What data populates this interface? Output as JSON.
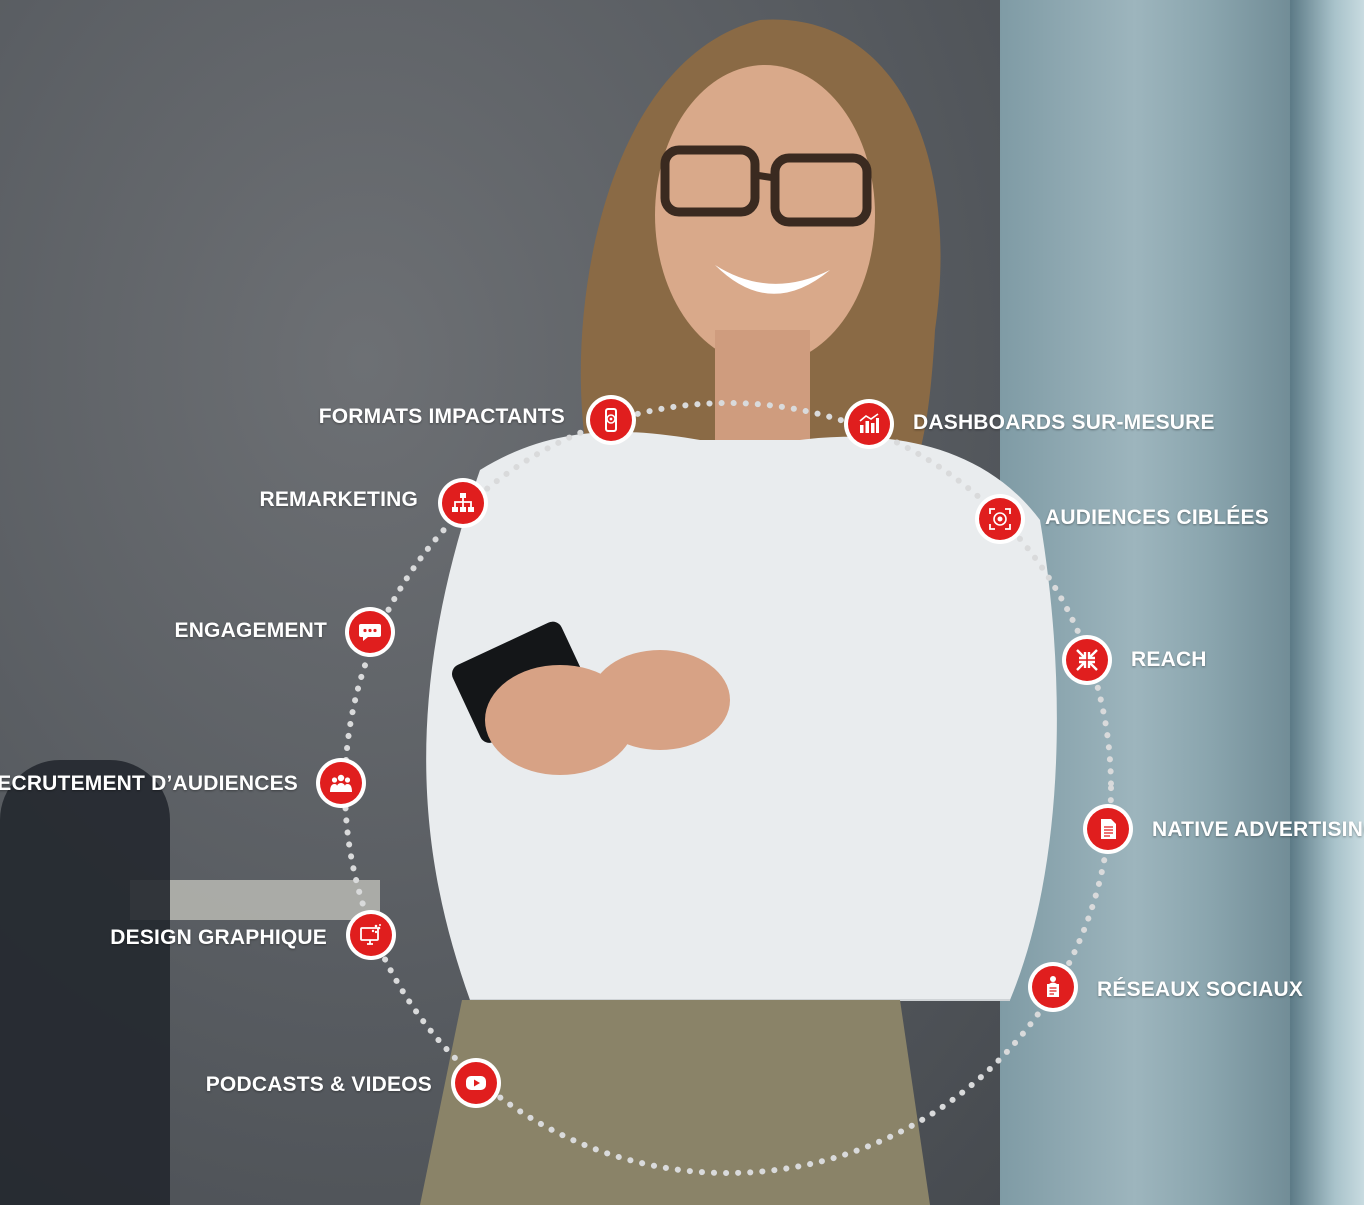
{
  "services": [
    {
      "label": "FORMATS IMPACTANTS",
      "icon": "mobile-target-icon"
    },
    {
      "label": "DASHBOARDS SUR-MESURE",
      "icon": "bar-chart-icon"
    },
    {
      "label": "REMARKETING",
      "icon": "sitemap-icon"
    },
    {
      "label": "AUDIENCES CIBLÉES",
      "icon": "target-icon"
    },
    {
      "label": "ENGAGEMENT",
      "icon": "chat-bubble-icon"
    },
    {
      "label": "REACH",
      "icon": "arrows-in-icon"
    },
    {
      "label": "RECRUTEMENT D’AUDIENCES",
      "icon": "people-group-icon"
    },
    {
      "label": "NATIVE ADVERTISING",
      "icon": "document-icon"
    },
    {
      "label": "DESIGN GRAPHIQUE",
      "icon": "monitor-design-icon"
    },
    {
      "label": "RÉSEAUX SOCIAUX",
      "icon": "profile-card-icon"
    },
    {
      "label": "PODCASTS & VIDEOS",
      "icon": "play-button-icon"
    }
  ],
  "colors": {
    "accent": "#e01e1e",
    "label": "#ffffff"
  }
}
